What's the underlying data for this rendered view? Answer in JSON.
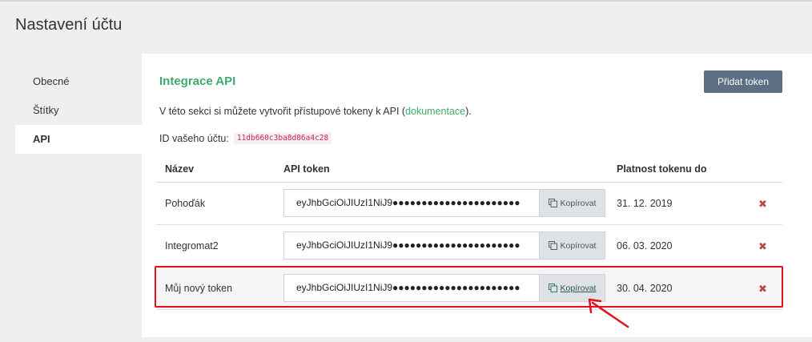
{
  "page": {
    "title": "Nastavení účtu"
  },
  "sidebar": {
    "items": [
      {
        "label": "Obecné"
      },
      {
        "label": "Štítky"
      },
      {
        "label": "API"
      }
    ]
  },
  "api": {
    "title": "Integrace API",
    "add_button": "Přidat token",
    "intro_before": "V této sekci si můžete vytvořit přístupové tokeny k API (",
    "intro_link": "dokumentace",
    "intro_after": ").",
    "account_label": "ID vašeho účtu:",
    "account_id": "11db660c3ba8d86a4c28"
  },
  "table": {
    "headers": {
      "name": "Název",
      "token": "API token",
      "expiry": "Platnost tokenu do"
    },
    "copy_label": "Kopírovat",
    "delete_symbol": "✖",
    "rows": [
      {
        "name": "Pohoďák",
        "token": "eyJhbGciOiJIUzI1NiJ9●●●●●●●●●●●●●●●●●●●●●●",
        "expiry": "31. 12. 2019"
      },
      {
        "name": "Integromat2",
        "token": "eyJhbGciOiJIUzI1NiJ9●●●●●●●●●●●●●●●●●●●●●●",
        "expiry": "06. 03. 2020"
      },
      {
        "name": "Můj nový token",
        "token": "eyJhbGciOiJIUzI1NiJ9●●●●●●●●●●●●●●●●●●●●●●",
        "expiry": "30. 04. 2020"
      }
    ]
  },
  "annotation": {
    "color": "#e3111c"
  },
  "icons": {
    "copy": "copy-icon",
    "delete": "delete-icon"
  }
}
